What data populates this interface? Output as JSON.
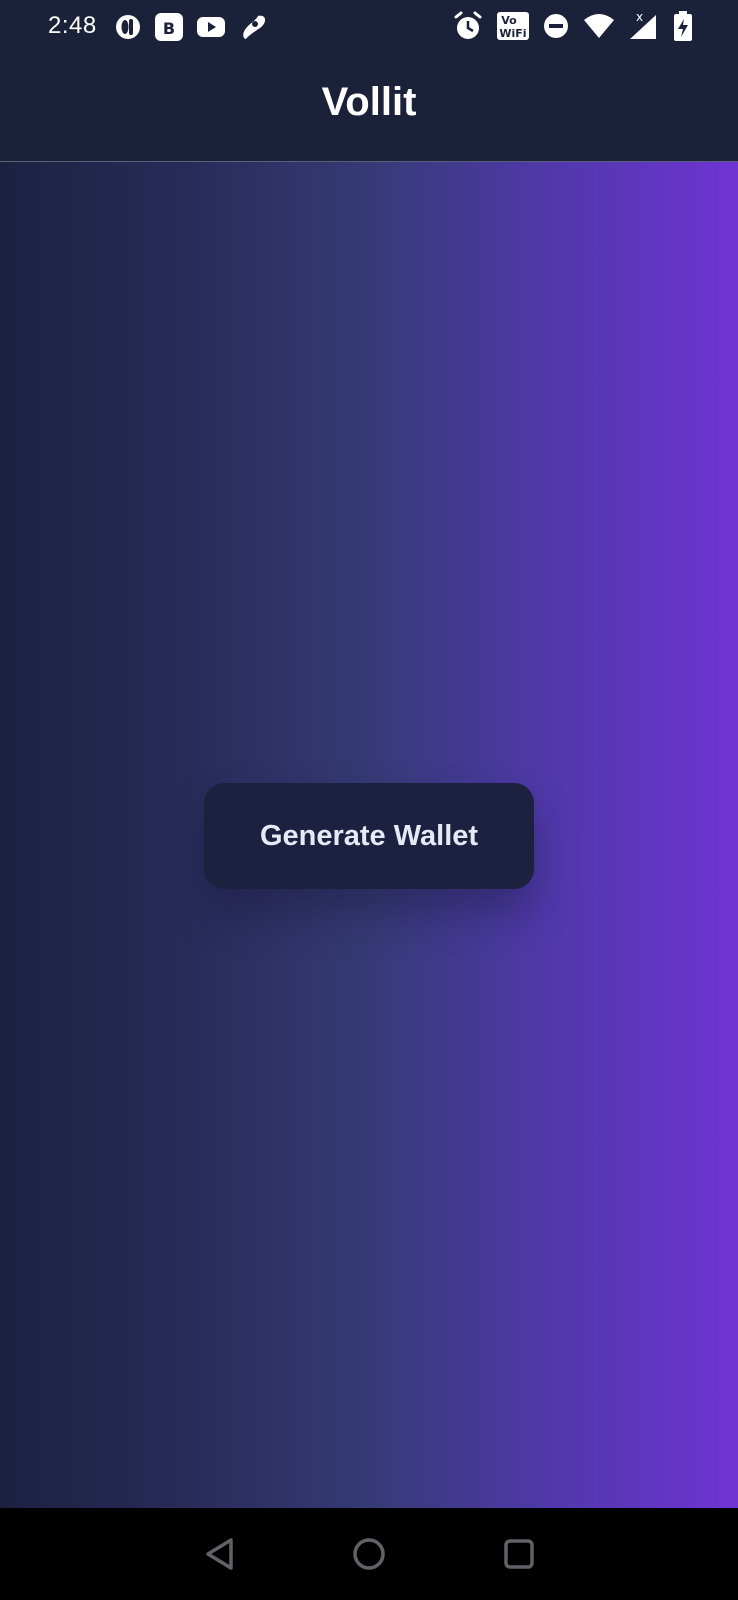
{
  "status_bar": {
    "time": "2:48",
    "left_icons": [
      "opera-icon",
      "b-app-icon",
      "youtube-icon",
      "airtel-icon"
    ],
    "right_icons": [
      "alarm-icon",
      "vowifi-icon",
      "dnd-icon",
      "wifi-icon",
      "signal-icon",
      "battery-charging-icon"
    ],
    "vowifi_text": "Vo\nWiFi"
  },
  "app_bar": {
    "title": "Vollit"
  },
  "main": {
    "generate_button_label": "Generate Wallet"
  },
  "nav_bar": {
    "buttons": [
      "back-icon",
      "home-icon",
      "recents-icon"
    ]
  },
  "colors": {
    "header_bg": "#1b2139",
    "gradient_start": "#1d2140",
    "gradient_mid": "#363a75",
    "gradient_end": "#6f34d4",
    "button_bg": "#1c2140",
    "button_text": "#e7e9f4",
    "nav_bg": "#000000"
  }
}
